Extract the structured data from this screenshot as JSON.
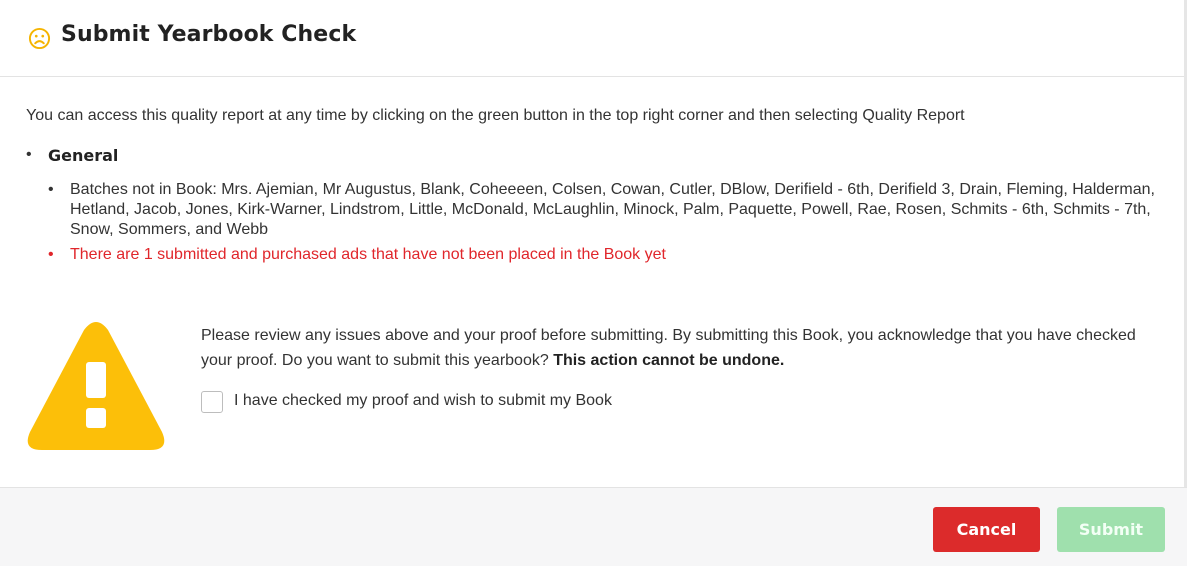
{
  "dialog": {
    "title": "Submit Yearbook Check",
    "title_icon": "sad-face-icon",
    "accent_color": "#f5b400"
  },
  "intro": "You can access this quality report at any time by clicking on the green button in the top right corner and then selecting Quality Report",
  "section": {
    "bullet": "•",
    "heading": "General",
    "issues": [
      {
        "bullet": "•",
        "text": "Batches not in Book: Mrs. Ajemian, Mr Augustus, Blank, Coheeeen, Colsen, Cowan, Cutler, DBlow, Derifield - 6th, Derifield 3, Drain, Fleming, Halderman, Hetland, Jacob, Jones, Kirk-Warner, Lindstrom, Little, McDonald, McLaughlin, Minock, Palm, Paquette, Powell, Rae, Rosen, Schmits - 6th, Schmits - 7th, Snow, Sommers, and Webb",
        "severity": "info"
      },
      {
        "bullet": "•",
        "text": "There are 1 submitted and purchased ads that have not been placed in the Book yet",
        "severity": "error",
        "color": "#e0262b"
      }
    ]
  },
  "warning": {
    "icon": "warning-triangle-icon",
    "color": "#fcbf09",
    "message": "Please review any issues above and your proof before submitting. By submitting this Book, you acknowledge that you have checked your proof. Do you want to submit this yearbook?",
    "emphasis": "This action cannot be undone."
  },
  "confirm_checkbox": {
    "label": "I have checked my proof and wish to submit my Book",
    "checked": false
  },
  "footer": {
    "cancel_label": "Cancel",
    "cancel_color": "#dc2b2b",
    "submit_label": "Submit",
    "submit_color": "#9fe0ad",
    "submit_enabled": false
  }
}
